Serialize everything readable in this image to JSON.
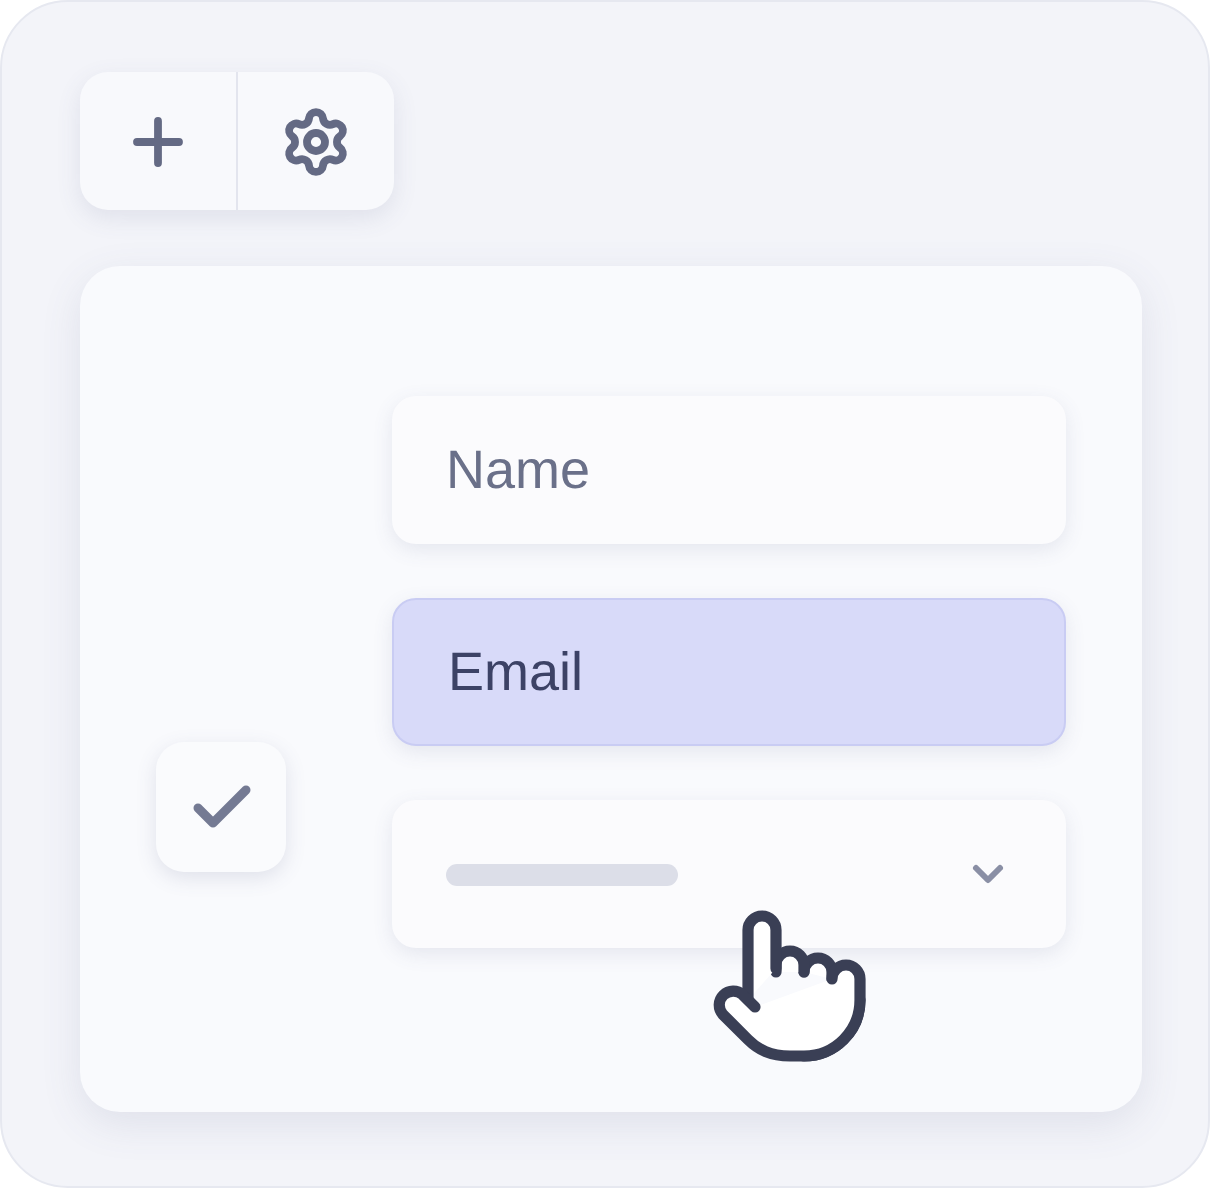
{
  "toolbar": {
    "buttons": [
      {
        "kind": "add"
      },
      {
        "kind": "settings"
      }
    ]
  },
  "form": {
    "checkbox": {
      "checked": true
    },
    "fields": [
      {
        "kind": "text",
        "placeholder": "Name",
        "selected": false
      },
      {
        "kind": "text",
        "placeholder": "Email",
        "selected": true
      },
      {
        "kind": "select",
        "selected": false
      }
    ]
  }
}
